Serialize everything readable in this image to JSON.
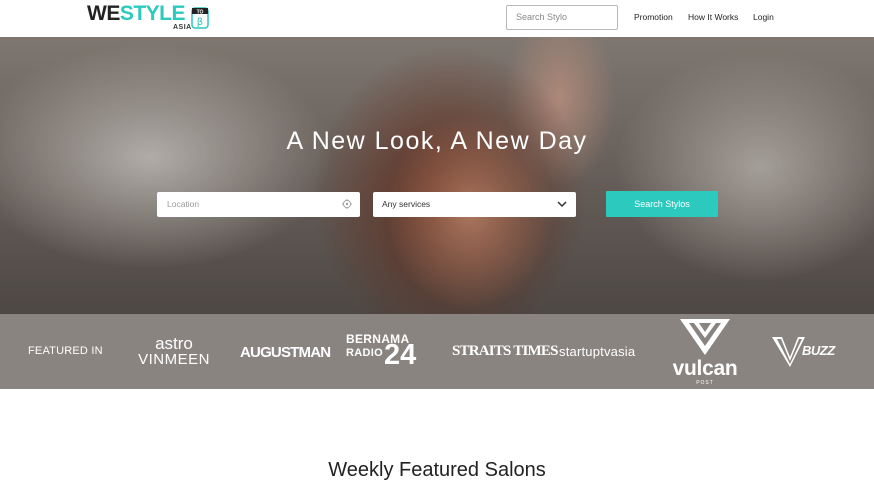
{
  "header": {
    "logo": {
      "part1": "WE",
      "part2": "STYLE",
      "sub": "ASIA",
      "badge_top": "TO",
      "badge_letter": "β"
    },
    "search_placeholder": "Search Stylo",
    "nav": [
      {
        "label": "Promotion"
      },
      {
        "label": "How It Works"
      },
      {
        "label": "Login"
      }
    ]
  },
  "hero": {
    "title": "A New Look, A New Day",
    "location_placeholder": "Location",
    "services_selected": "Any services",
    "search_button": "Search Stylos"
  },
  "featured": {
    "label": "FEATURED IN",
    "publications": [
      {
        "line1": "astro",
        "line2": "VINMEEN"
      },
      {
        "name": "AUGUSTMAN"
      },
      {
        "line1": "BERNAMA",
        "line2": "RADIO",
        "line3": "24"
      },
      {
        "name": "STRAITS TIMES"
      },
      {
        "name": "startuptvasia"
      },
      {
        "name": "vulcan",
        "sub": "POST"
      },
      {
        "name": "BUZZ"
      }
    ]
  },
  "section": {
    "title": "Weekly Featured Salons"
  },
  "colors": {
    "accent": "#2cc9bf",
    "featured_bg": "#8a8481"
  }
}
